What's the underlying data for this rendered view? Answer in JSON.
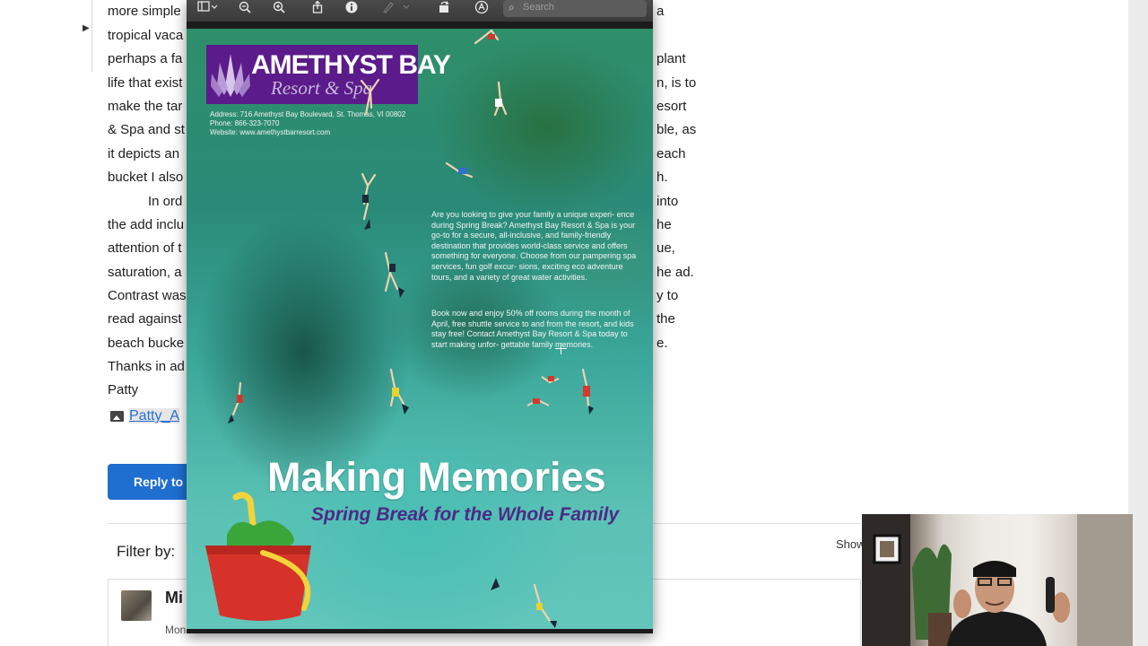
{
  "article": {
    "lines": [
      {
        "text": "more simple",
        "right": "a"
      },
      {
        "text": "tropical vaca",
        "right": ""
      },
      {
        "text": "perhaps a fa",
        "right": "plant"
      },
      {
        "text": "life that exist",
        "right": "n, is to"
      },
      {
        "text": "make the tar",
        "right": "esort"
      },
      {
        "text": "& Spa and st",
        "right": "ble, as"
      },
      {
        "text": "it depicts an",
        "right": "each"
      },
      {
        "text": "bucket I also",
        "right": "h."
      },
      {
        "text": "In ord",
        "right": "into"
      },
      {
        "text": "the add inclu",
        "right": "he"
      },
      {
        "text": "attention of t",
        "right": "ue,"
      },
      {
        "text": "saturation, a",
        "right": "he ad."
      },
      {
        "text": "Contrast was",
        "right": "y to"
      },
      {
        "text": "read against",
        "right": "the"
      },
      {
        "text": "beach bucke",
        "right": "e."
      },
      {
        "text": "Thanks in ad",
        "right": ""
      },
      {
        "text": "Patty",
        "right": ""
      }
    ],
    "attachment_link": "Patty_A",
    "reply_button": "Reply to T",
    "filter_label": "Filter by:",
    "show_label": "Show",
    "comment": {
      "name": "Mi",
      "meta": "Mon"
    }
  },
  "viewer": {
    "search_placeholder": "Search",
    "flyer": {
      "logo_top": "AMETHYST BAY",
      "logo_bottom": "Resort & Spa",
      "address_lines": [
        "Address:  716 Amethyst Bay Boulevard, St. Thomas, VI 00802",
        "Phone:     866-323-7070",
        "Website:  www.amethystbarresort.com"
      ],
      "paragraph1": "Are you looking to give your family a unique experi- ence during Spring Break? Amethyst Bay Resort & Spa is your go-to for a secure, all-inclusive, and family-friendly destination that provides world-class service and offers something for everyone. Choose from our pampering spa services, fun golf excur- sions, exciting eco adventure tours, and a variety of great water activities.",
      "paragraph2": "Book now and enjoy 50% off rooms during the month of April, free shuttle service to and from the resort, and kids stay free! Contact Amethyst Bay Resort & Spa today to start making unfor- gettable family memories.",
      "headline": "Making Memories",
      "subheadline": "Spring Break for the Whole Family"
    }
  },
  "colors": {
    "link": "#2a6fd6",
    "reply_button": "#1f6fd1",
    "logo_purple": "#5b1b8a",
    "subheadline_purple": "#4e2a87"
  }
}
